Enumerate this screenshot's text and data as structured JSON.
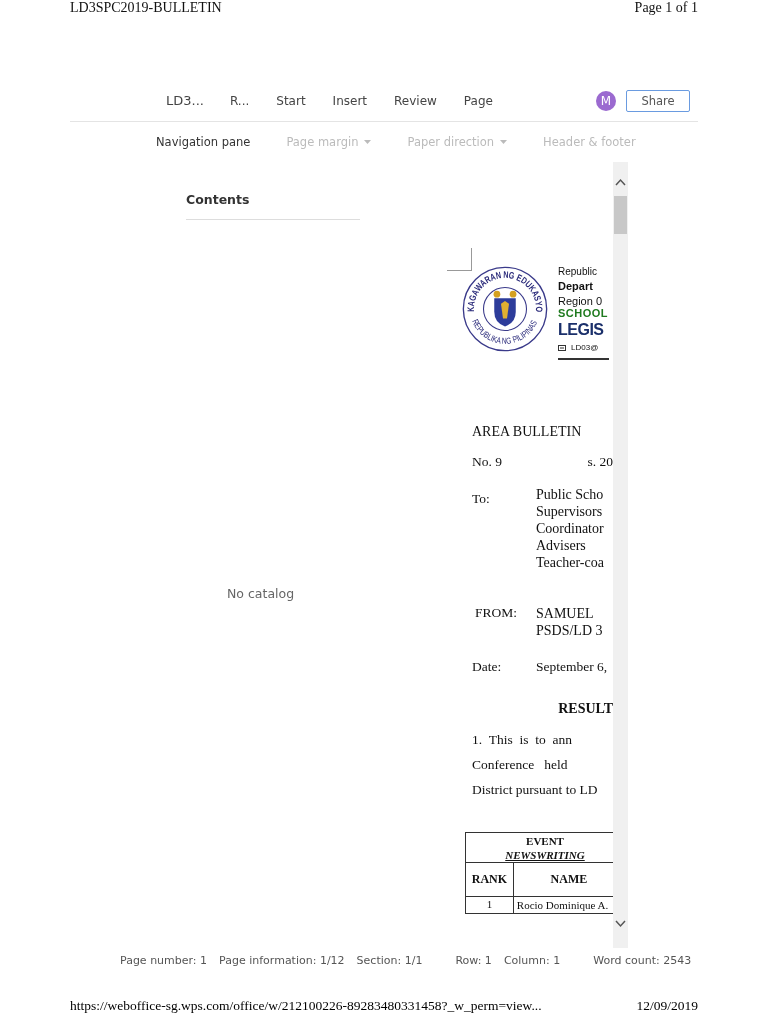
{
  "print_header": {
    "title": "LD3SPC2019-BULLETIN",
    "page": "Page 1 of 1"
  },
  "toolbar": {
    "tabs": [
      {
        "label": "LD3..."
      },
      {
        "label": "R..."
      },
      {
        "label": "Start"
      },
      {
        "label": "Insert"
      },
      {
        "label": "Review"
      },
      {
        "label": "Page"
      }
    ],
    "avatar": "M",
    "share": "Share"
  },
  "ribbon": [
    {
      "label": "Navigation pane",
      "disabled": false,
      "dropdown": false
    },
    {
      "label": "Page margin",
      "disabled": true,
      "dropdown": true
    },
    {
      "label": "Paper direction",
      "disabled": true,
      "dropdown": true
    },
    {
      "label": "Header & footer",
      "disabled": true,
      "dropdown": false
    }
  ],
  "navigation_pane": {
    "title": "Contents",
    "empty_text": "No catalog"
  },
  "document": {
    "seal": {
      "top_text": "KAGAWARAN NG EDUKASYON",
      "bottom_text": "REPUBLIKA NG PILIPINAS"
    },
    "letterhead": {
      "line_1": "Republic",
      "line_2": "Depart",
      "line_3": "Region 0",
      "line_4": "SCHOOL",
      "line_5": "LEGIS",
      "email": "LD03@"
    },
    "heading": "AREA BULLETIN",
    "number": "No. 9",
    "series": "s. 20",
    "to_label": "To:",
    "to_lines": [
      "Public Scho",
      "Supervisors",
      "Coordinator",
      "Advisers",
      "Teacher-coa"
    ],
    "from_label": "FROM:",
    "from_lines": [
      "SAMUEL",
      "PSDS/LD 3"
    ],
    "date_label": "Date:",
    "date": "September 6,",
    "title": "RESULT",
    "paragraph_lines": [
      "1.  This  is  to  ann",
      "Conference   held",
      "District pursuant to LD"
    ],
    "table": {
      "event_label": "EVENT",
      "event": "NEWSWRITING",
      "columns": [
        "RANK",
        "NAME"
      ],
      "rows": [
        [
          "1",
          "Rocio Dominique A."
        ]
      ]
    }
  },
  "status_bar": [
    "Page number: 1",
    "Page information: 1/12",
    "Section: 1/1",
    "Row: 1",
    "Column: 1",
    "Word count: 2543"
  ],
  "print_footer": {
    "url": "https://weboffice-sg.wps.com/office/w/212100226-89283480331458?_w_perm=view...",
    "date": "12/09/2019"
  }
}
